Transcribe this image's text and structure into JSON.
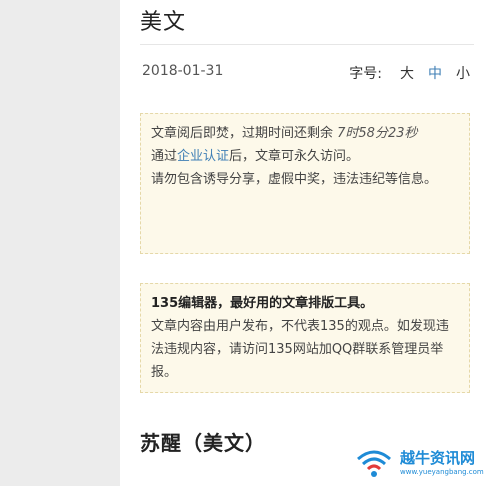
{
  "article": {
    "title": "美文",
    "date": "2018-01-31",
    "font_size": {
      "label": "字号:",
      "options": [
        "大",
        "中",
        "小"
      ],
      "active_color": "#3f7fb5"
    }
  },
  "notice1": {
    "line1_prefix": "文章阅后即焚，过期时间还剩余 ",
    "countdown": "7时58分23秒",
    "line2_prefix": "通过",
    "link": "企业认证",
    "line2_suffix": "后，文章可永久访问。",
    "line3": "请勿包含诱导分享，虚假中奖，违法违纪等信息。"
  },
  "notice2": {
    "heading": "135编辑器，最好用的文章排版工具。",
    "body": "文章内容由用户发布，不代表135的观点。如发现违法违规内容，请访问135网站加QQ群联系管理员举报。"
  },
  "subtitle": "苏醒（美文）",
  "watermark": {
    "name": "越牛资讯网",
    "url": "www.yueyangbang.com"
  },
  "colors": {
    "notice_bg": "#fdf9ea",
    "notice_border": "#e5d8a8",
    "link": "#3f7fb5",
    "watermark": "#1e8bd6"
  }
}
